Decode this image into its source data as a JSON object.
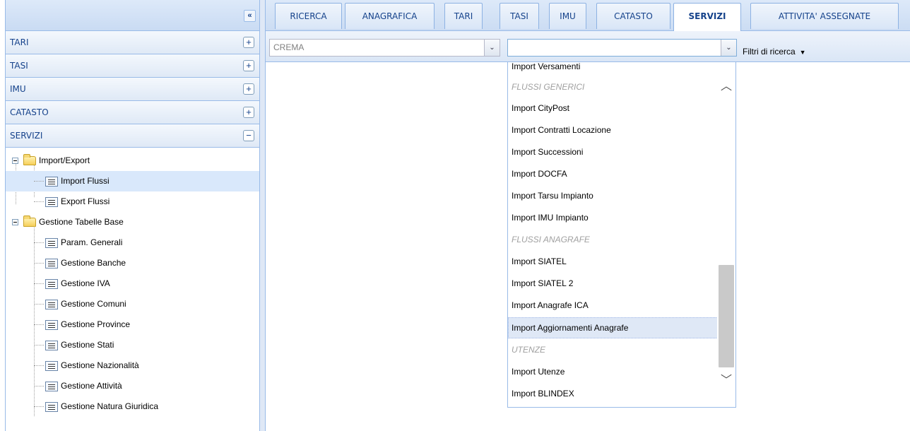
{
  "sidebar": {
    "collapse_icon": "double-chevron-left-icon",
    "sections": [
      {
        "label": "TARI",
        "tool": "+"
      },
      {
        "label": "TASI",
        "tool": "+"
      },
      {
        "label": "IMU",
        "tool": "+"
      },
      {
        "label": "CATASTO",
        "tool": "+"
      },
      {
        "label": "SERVIZI",
        "tool": "−"
      }
    ],
    "tree": {
      "folder1": "Import/Export",
      "folder1_items": [
        "Import Flussi",
        "Export Flussi"
      ],
      "folder2": "Gestione Tabelle Base",
      "folder2_items": [
        "Param. Generali",
        "Gestione Banche",
        "Gestione IVA",
        "Gestione Comuni",
        "Gestione Province",
        "Gestione Stati",
        "Gestione Nazionalità",
        "Gestione Attività",
        "Gestione Natura Giuridica"
      ],
      "selected": "Import Flussi"
    }
  },
  "tabs": [
    "RICERCA",
    "ANAGRAFICA",
    "TARI",
    "TASI",
    "IMU",
    "CATASTO",
    "SERVIZI",
    "ATTIVITA' ASSEGNATE"
  ],
  "active_tab": "SERVIZI",
  "toolbar": {
    "comune_combo_value": "CREMA",
    "flusso_combo_value": "",
    "filtri_label": "Filtri di ricerca",
    "filtri_arrow": "▼",
    "combo_arrow": "⌄"
  },
  "dropdown": {
    "items": [
      {
        "label": "Import Versamenti",
        "type": "item"
      },
      {
        "label": "FLUSSI GENERICI",
        "type": "group"
      },
      {
        "label": "Import CityPost",
        "type": "item"
      },
      {
        "label": "Import Contratti Locazione",
        "type": "item"
      },
      {
        "label": "Import Successioni",
        "type": "item"
      },
      {
        "label": "Import DOCFA",
        "type": "item"
      },
      {
        "label": "Import Tarsu Impianto",
        "type": "item"
      },
      {
        "label": "Import IMU Impianto",
        "type": "item"
      },
      {
        "label": "FLUSSI ANAGRAFE",
        "type": "group"
      },
      {
        "label": "Import SIATEL",
        "type": "item"
      },
      {
        "label": "Import SIATEL 2",
        "type": "item"
      },
      {
        "label": "Import Anagrafe ICA",
        "type": "item"
      },
      {
        "label": "Import Aggiornamenti Anagrafe",
        "type": "highlight"
      },
      {
        "label": "UTENZE",
        "type": "group"
      },
      {
        "label": "Import Utenze",
        "type": "item"
      },
      {
        "label": "Import BLINDEX",
        "type": "item"
      }
    ],
    "scroll_up_glyph": "︿",
    "scroll_down_glyph": "﹀"
  }
}
